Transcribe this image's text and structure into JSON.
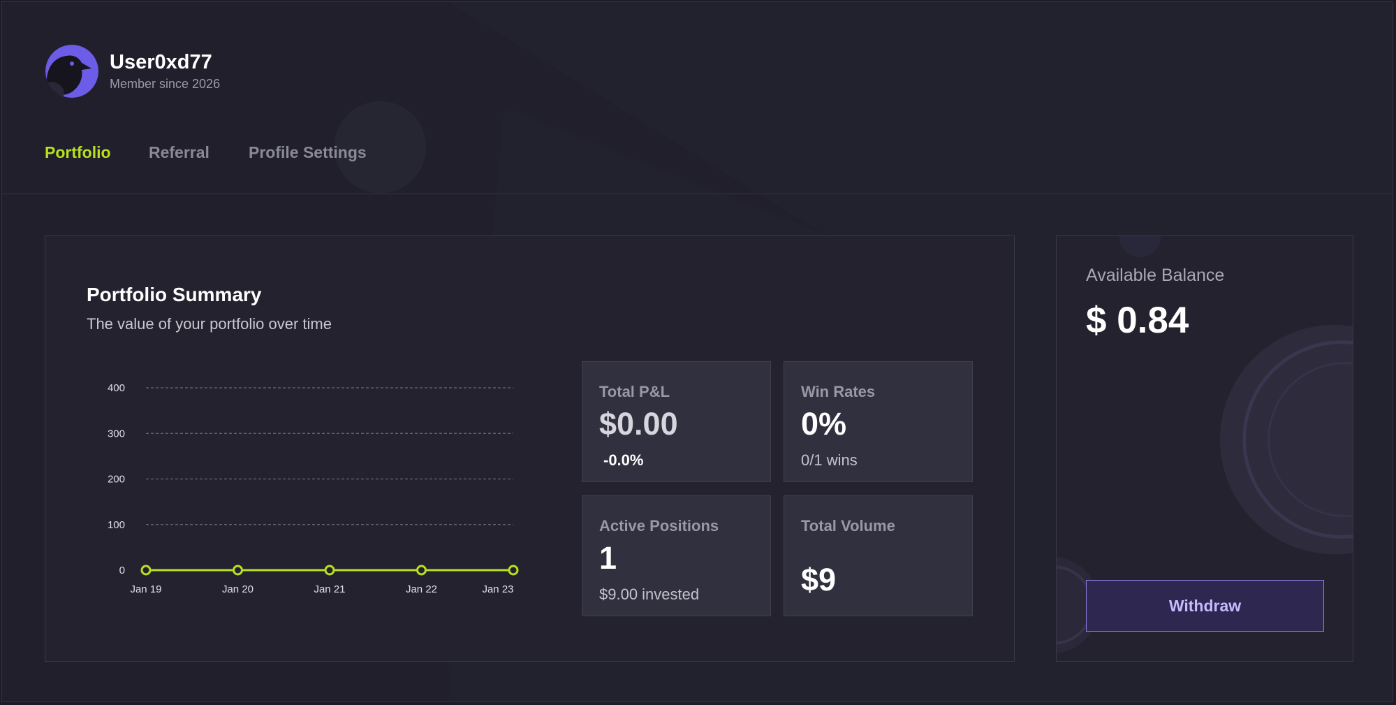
{
  "user": {
    "name": "User0xd77",
    "member_since": "Member since 2026"
  },
  "tabs": [
    {
      "label": "Portfolio",
      "active": true
    },
    {
      "label": "Referral",
      "active": false
    },
    {
      "label": "Profile Settings",
      "active": false
    }
  ],
  "summary": {
    "title": "Portfolio Summary",
    "subtitle": "The value of your portfolio over time"
  },
  "chart_data": {
    "type": "line",
    "title": "",
    "xlabel": "",
    "ylabel": "",
    "x": [
      "Jan 19",
      "Jan 20",
      "Jan 21",
      "Jan 22",
      "Jan 23"
    ],
    "series": [
      {
        "values": [
          0,
          0,
          0,
          0,
          0
        ]
      }
    ],
    "y_ticks": [
      0,
      100,
      200,
      300,
      400
    ],
    "ylim": [
      0,
      400
    ],
    "grid": true,
    "line_color": "#b8e01f"
  },
  "stats": {
    "total_pnl": {
      "label": "Total P&L",
      "value": "$0.00",
      "sub": "-0.0%"
    },
    "win_rates": {
      "label": "Win Rates",
      "value": "0%",
      "sub": "0/1 wins"
    },
    "active_positions": {
      "label": "Active Positions",
      "value": "1",
      "sub": "$9.00 invested"
    },
    "total_volume": {
      "label": "Total Volume",
      "value": "$9"
    }
  },
  "balance": {
    "label": "Available Balance",
    "value": "$ 0.84",
    "withdraw_label": "Withdraw"
  },
  "colors": {
    "accent": "#b8e01f",
    "brand": "#6c5ce7",
    "background": "#201f2b"
  },
  "icons": {
    "avatar": "raven-avatar-icon"
  }
}
